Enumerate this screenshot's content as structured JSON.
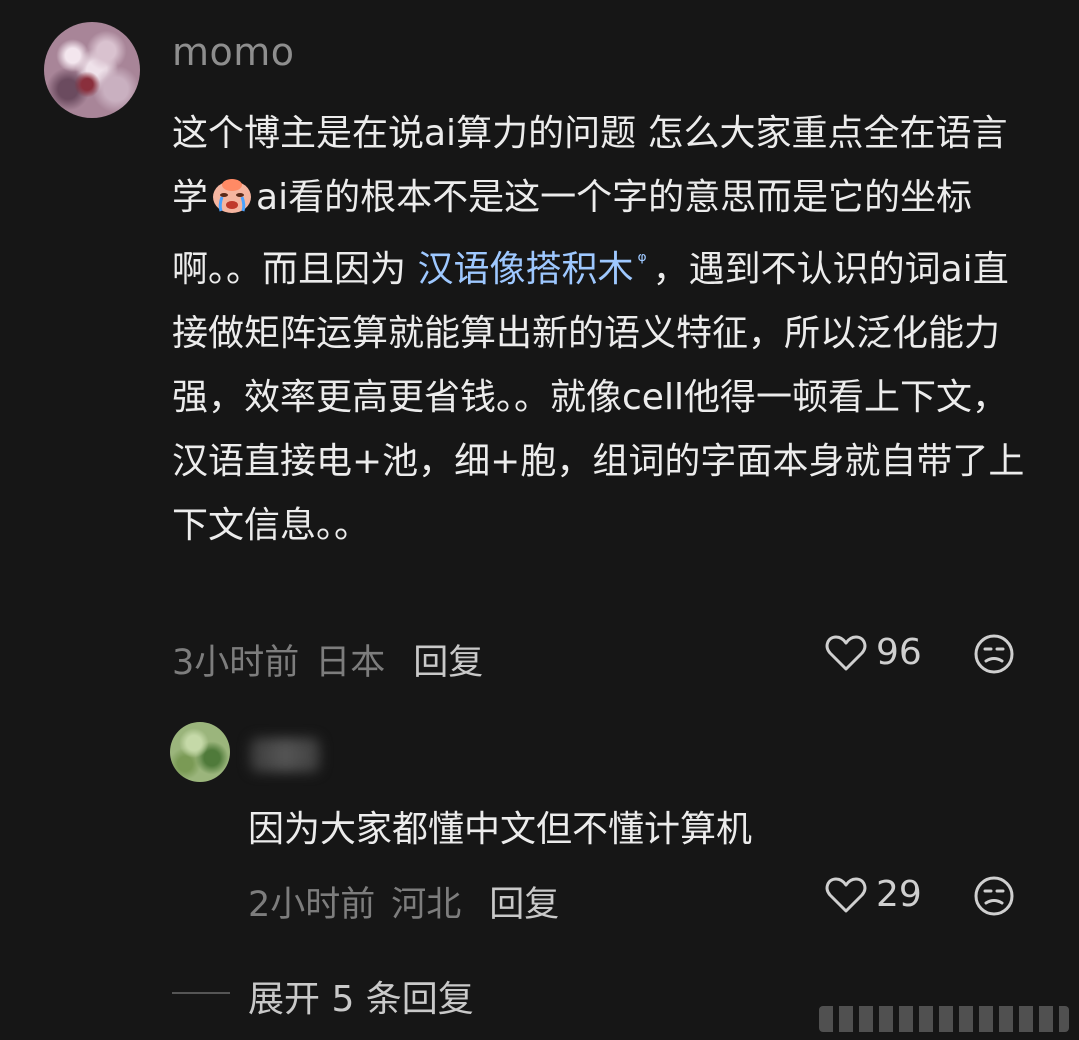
{
  "comment": {
    "username": "momo",
    "text_parts": {
      "p1": "这个博主是在说ai算力的问题 怎么大家重点全在语言学",
      "p2": "ai看的根本不是这一个字的意思而是它的坐标啊。。而且因为 ",
      "topic": "汉语像搭积木",
      "topic_icon": "ᵠ",
      "p3": "，遇到不认识的词ai直接做矩阵运算就能算出新的语义特征，所以泛化能力强，效率更高更省钱。。就像cell他得一顿看上下文，汉语直接电+池，细+胞，组词的字面本身就自带了上下文信息。。"
    },
    "emoji": "crying-face-emoji",
    "time": "3小时前",
    "location": "日本",
    "reply_label": "回复",
    "likes": "96"
  },
  "reply": {
    "text": "因为大家都懂中文但不懂计算机",
    "time": "2小时前",
    "location": "河北",
    "reply_label": "回复",
    "likes": "29"
  },
  "expand": {
    "label": "展开 5 条回复"
  },
  "icons": {
    "like": "heart-icon",
    "dislike": "unhappy-face-icon"
  },
  "colors": {
    "background": "#161616",
    "link": "#9ec8ff",
    "muted": "#7d7d7d"
  }
}
